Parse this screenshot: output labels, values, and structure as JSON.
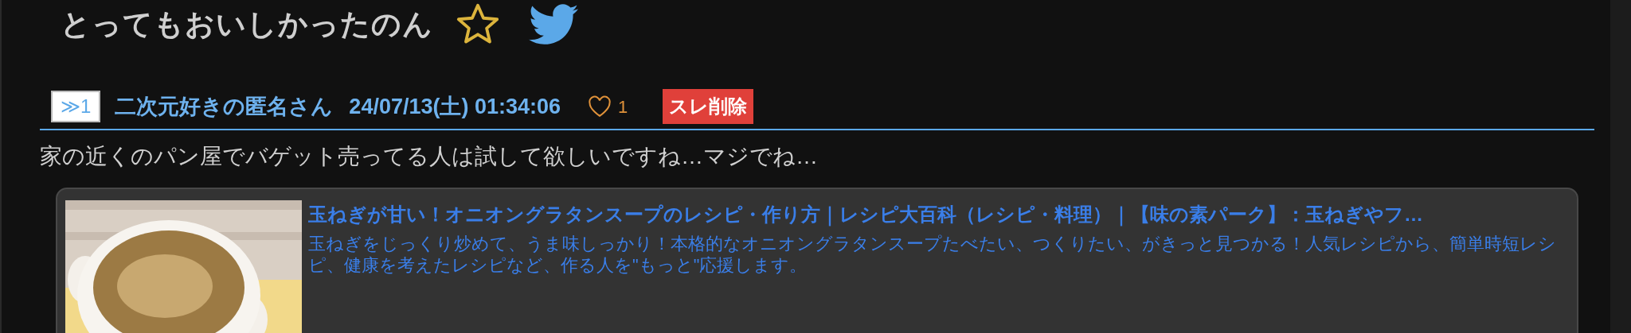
{
  "thread": {
    "title": "とってもおいしかったのん",
    "favorited": false
  },
  "post": {
    "number": "≫1",
    "author": "二次元好きの匿名さん",
    "datetime": "24/07/13(土) 01:34:06",
    "likes": "1",
    "liked": false,
    "delete_label": "スレ削除",
    "body": "家の近くのパン屋でバゲット売ってる人は試して欲しいですね…マジでね…",
    "link_card": {
      "title": "玉ねぎが甘い！オニオングラタンスープのレシピ・作り方｜レシピ大百科（レシピ・料理）｜【味の素パーク】：玉ねぎやフ…",
      "description": "玉ねぎをじっくり炒めて、うま味しっかり！本格的なオニオングラタンスープたべたい、つくりたい、がきっと見つかる！人気レシピから、簡単時短レシピ、健康を考えたレシピなど、作る人を\"もっと\"応援します。"
    }
  }
}
